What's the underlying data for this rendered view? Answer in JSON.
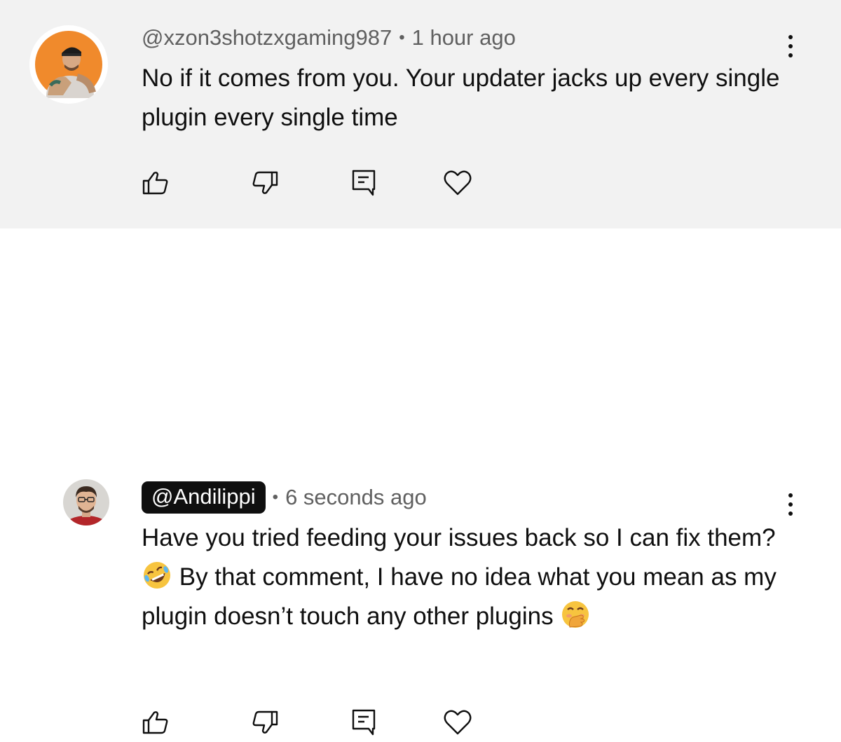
{
  "comments": [
    {
      "handle": "@xzon3shotzxgaming987",
      "separator": "•",
      "time": "1 hour ago",
      "text": "No if it comes from you. Your updater jacks up every single plugin every single time",
      "highlighted": false
    },
    {
      "handle": "@Andilippi",
      "separator": "•",
      "time": "6 seconds ago",
      "text_parts": [
        "Have you tried feeding your issues back so I can fix them? ",
        " By that comment, I have no idea what you mean as my plugin doesn’t touch any other plugins "
      ],
      "emojis": [
        "rolling-on-floor-laughing-emoji",
        "hand-over-mouth-emoji"
      ],
      "highlighted": true
    }
  ],
  "icons": {
    "like": "thumbs-up-icon",
    "dislike": "thumbs-down-icon",
    "reply": "comment-icon",
    "heart": "heart-icon",
    "more": "more-vertical-icon"
  },
  "colors": {
    "highlight_bg": "#f2f2f2",
    "text": "#0f0f0f",
    "meta": "#606060",
    "handle_chip": "#0f0f0f"
  }
}
